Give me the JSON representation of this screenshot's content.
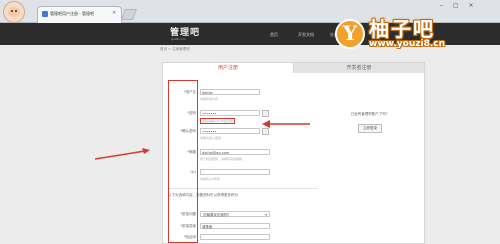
{
  "browser": {
    "tab_title": "管理吧用户注册 - 管理吧",
    "close_glyph": "×",
    "window_controls": "– ▢ ×"
  },
  "site": {
    "logo": "管理吧",
    "logo_sub": "guli8.com",
    "nav": [
      "首页",
      "开发文档",
      "社区"
    ]
  },
  "breadcrumb": "首页 > 注册管理吧",
  "tabs": {
    "user": "用户注册",
    "developer": "开发者注册"
  },
  "form": {
    "username": {
      "label": "*用户名",
      "value": "daifox",
      "hint": "请填写用户名"
    },
    "password": {
      "label": "*密码",
      "value": "•••••••",
      "hint": "密码请输入6-16位字母"
    },
    "confirm": {
      "label": "*确认密码",
      "value": "•••••••",
      "hint": "请再次输入密码"
    },
    "email": {
      "label": "*邮箱",
      "value": "daifox@qq.com",
      "hint": "用于找回密码，请填写真实邮箱"
    },
    "qq": {
      "label": "QQ",
      "value": "",
      "hint": "请填写QQ号码"
    },
    "section_note": "以下为选填内容，完善资料可以获得更多积分",
    "question": {
      "label": "*密保问题",
      "value": "您最喜欢的食物？"
    },
    "answer": {
      "label": "*密保答案",
      "value": "清蒸鱼"
    },
    "code": {
      "label": "*验证码",
      "value": ""
    }
  },
  "side": {
    "text": "已经有管理吧账户了吗？",
    "login_button": "立即登录"
  },
  "watermark": {
    "letter": "Y",
    "brand": "柚子吧",
    "url": "www.youzi8.cn"
  },
  "colors": {
    "accent_red": "#d43a2e",
    "header_dark": "#2c2c2c",
    "watermark_orange": "#f3a12c"
  }
}
